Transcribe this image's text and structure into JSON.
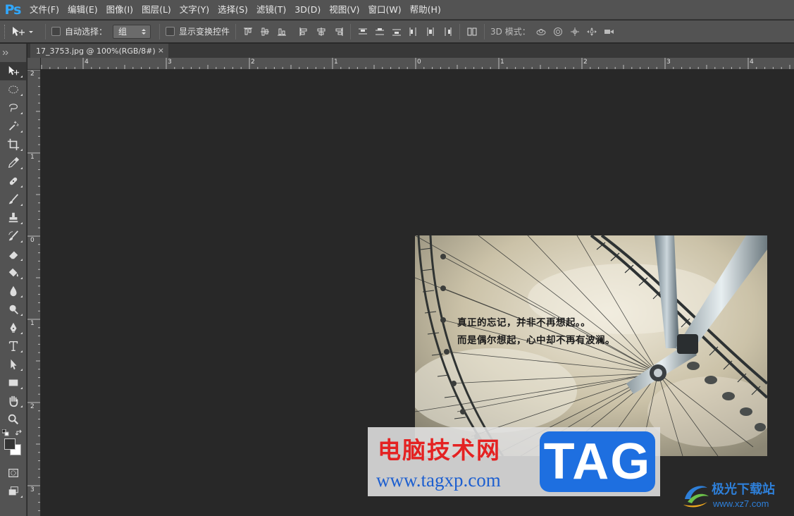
{
  "app": {
    "logo": "Ps"
  },
  "menu": {
    "items": [
      "文件(F)",
      "编辑(E)",
      "图像(I)",
      "图层(L)",
      "文字(Y)",
      "选择(S)",
      "滤镜(T)",
      "3D(D)",
      "视图(V)",
      "窗口(W)",
      "帮助(H)"
    ]
  },
  "options": {
    "auto_select_label": "自动选择：",
    "auto_select_value": "组",
    "show_transform_label": "显示变换控件",
    "mode_3d_label": "3D 模式："
  },
  "document": {
    "tab_title": "17_3753.jpg @ 100%(RGB/8#)",
    "close_glyph": "×"
  },
  "rulers": {
    "h_labels": [
      "4",
      "3",
      "2",
      "1",
      "0",
      "1",
      "2",
      "3",
      "4"
    ],
    "v_labels": [
      "2",
      "1",
      "0",
      "1",
      "2",
      "3"
    ]
  },
  "image": {
    "line1": "真正的忘记，并非不再想起。。",
    "line2": "而是偶尔想起，心中却不再有波澜。"
  },
  "watermark": {
    "cn": "电脑技术网",
    "url": "www.tagxp.com",
    "tag": "TAG",
    "site_name": "极光下载站",
    "site_url": "www.xz7.com"
  },
  "colors": {
    "panel": "#535353",
    "canvas": "#282828",
    "ps_blue": "#31a8ff",
    "tag_blue": "#1e6fe0",
    "watermark_red": "#e42222"
  }
}
